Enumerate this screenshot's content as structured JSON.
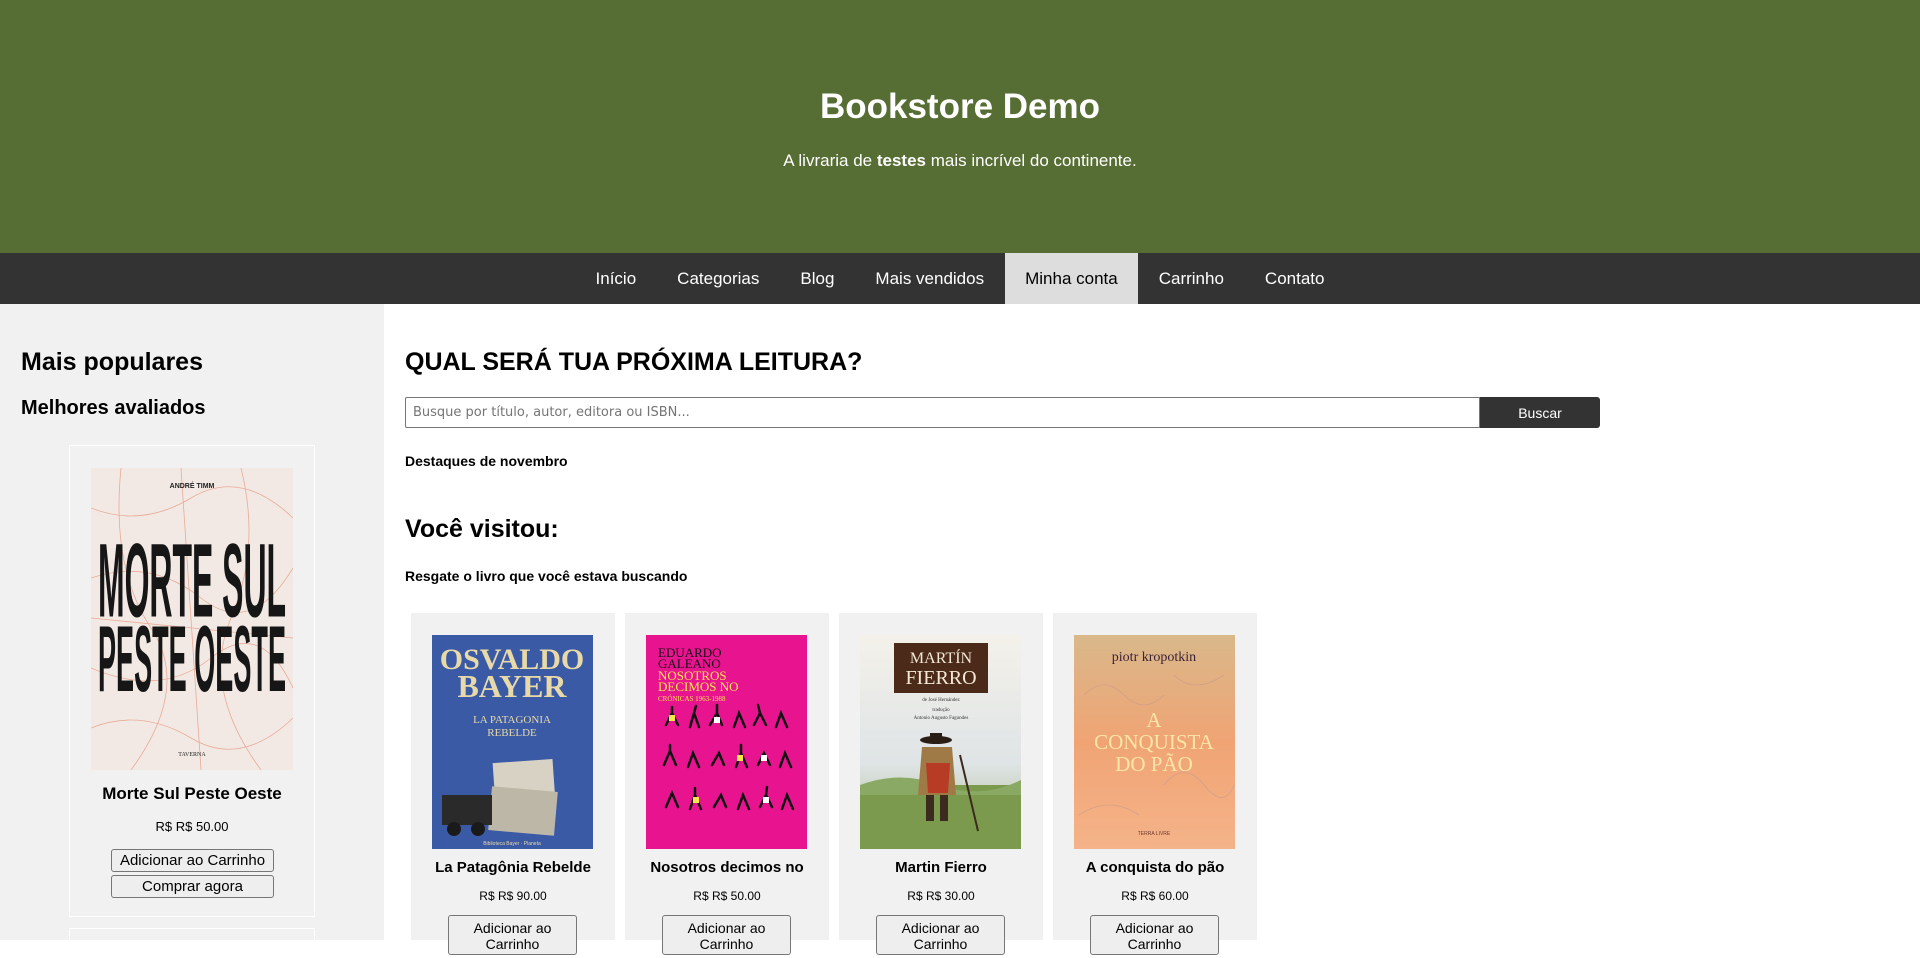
{
  "header": {
    "title": "Bookstore Demo",
    "tagline_before": "A livraria de",
    "tagline_bold": "testes",
    "tagline_after": "mais incrível do continente."
  },
  "nav": {
    "items": [
      "Início",
      "Categorias",
      "Blog",
      "Mais vendidos",
      "Minha conta",
      "Carrinho",
      "Contato"
    ],
    "active": "Minha conta"
  },
  "sidebar": {
    "title": "Mais populares",
    "subtitle": "Melhores avaliados",
    "featured": {
      "title": "Morte Sul Peste Oeste",
      "price": "R$ R$ 50.00",
      "author": "ANDRÉ TIMM",
      "publisher": "TAVERNA",
      "add_label": "Adicionar ao Carrinho",
      "buy_label": "Comprar agora"
    }
  },
  "main": {
    "heading": "QUAL SERÁ TUA PRÓXIMA LEITURA?",
    "search": {
      "placeholder": "Busque por título, autor, editora ou ISBN...",
      "button": "Buscar"
    },
    "highlights": "Destaques de novembro",
    "visited_heading": "Você visitou:",
    "visited_sub": "Resgate o livro que você estava buscando",
    "books": [
      {
        "title": "La Patagônia Rebelde",
        "price": "R$ R$ 90.00",
        "add_label": "Adicionar ao Carrinho"
      },
      {
        "title": "Nosotros decimos no",
        "price": "R$ R$ 50.00",
        "add_label": "Adicionar ao Carrinho"
      },
      {
        "title": "Martin Fierro",
        "price": "R$ R$ 30.00",
        "add_label": "Adicionar ao Carrinho"
      },
      {
        "title": "A conquista do pão",
        "price": "R$ R$ 60.00",
        "add_label": "Adicionar ao Carrinho"
      }
    ]
  },
  "covers": {
    "bayer": {
      "author": "OSVALDO BAYER",
      "line1": "OSVALDO",
      "line2": "BAYER",
      "title1": "LA PATAGONIA",
      "title2": "REBELDE",
      "publisher": "Biblioteca Bayer · Planeta"
    },
    "galeano": {
      "author1": "EDUARDO",
      "author2": "GALEANO",
      "title1": "NOSOTROS",
      "title2": "DECIMOS NO",
      "sub": "CRÓNICAS 1963-1988"
    },
    "fierro": {
      "title1": "MARTÍN",
      "title2": "FIERRO",
      "by": "de José Hernández",
      "trans1": "tradução",
      "trans2": "Antonio Augusto Fagundes"
    },
    "kropotkin": {
      "author": "piotr kropotkin",
      "title1": "A",
      "title2": "CONQUISTA",
      "title3": "DO PÃO",
      "publisher": "TERRA LIVRE"
    }
  },
  "colors": {
    "header_bg": "#566d33",
    "nav_bg": "#333333",
    "nav_active": "#dddddd",
    "sidebar_bg": "#f1f1f1",
    "search_button": "#333333"
  }
}
